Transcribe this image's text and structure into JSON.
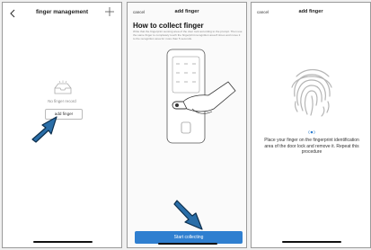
{
  "screen1": {
    "title": "finger management",
    "empty_text": "No finger record",
    "add_finger_label": "add finger"
  },
  "screen2": {
    "cancel_label": "cancel",
    "title": "add finger",
    "heading": "How to collect finger",
    "description": "Write that the fingerprint sensing area of the door lock according to the prompt. Then use the same finger to completely touch the fingerprint recognition area 8 times and move it to the recognition area for more than 5 seconds.",
    "start_label": "Start collecting",
    "accent_color": "#2f7fd0"
  },
  "screen3": {
    "cancel_label": "cancel",
    "title": "add finger",
    "instruction": "Place your finger on the fingerprint identification area of the door lock and remove it. Repeat this procedure"
  },
  "icons": {
    "back": "chevron-left-icon",
    "add": "plus-icon",
    "empty": "empty-inbox-icon",
    "pointer": "pointer-arrow-icon",
    "lock": "door-lock-illustration",
    "fingerprint": "fingerprint-icon",
    "signal": "signal-icon"
  },
  "arrow_color": "#2a6ea8"
}
